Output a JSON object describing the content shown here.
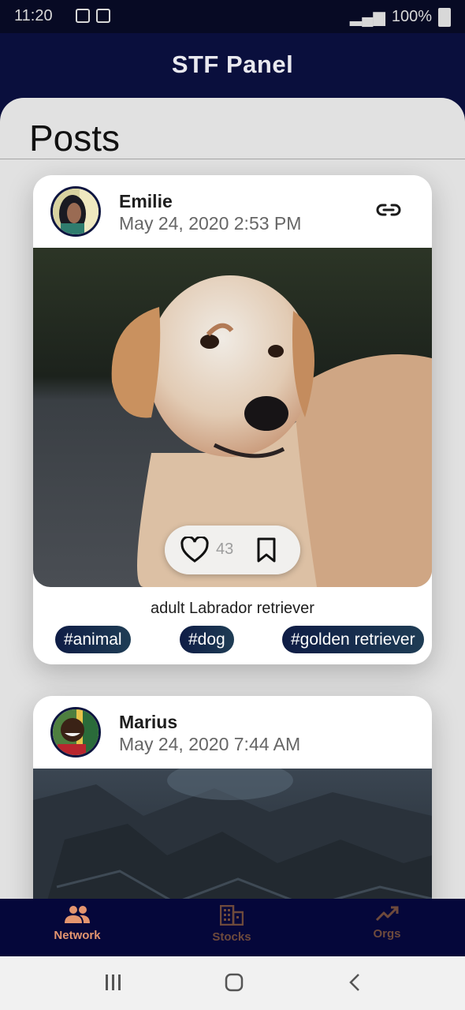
{
  "status_bar": {
    "time": "11:20",
    "battery": "100%"
  },
  "app_bar": {
    "title": "STF Panel"
  },
  "page": {
    "title": "Posts"
  },
  "posts": [
    {
      "author": "Emilie",
      "date": "May 24, 2020 2:53 PM",
      "likes": "43",
      "caption": "adult Labrador retriever",
      "tags": [
        "#animal",
        "#dog",
        "#golden retriever"
      ]
    },
    {
      "author": "Marius",
      "date": "May 24, 2020 7:44 AM"
    }
  ],
  "bottom_nav": {
    "items": [
      {
        "label": "Network",
        "icon": "people-icon",
        "active": true
      },
      {
        "label": "Stocks",
        "icon": "building-icon",
        "active": false
      },
      {
        "label": "Orgs",
        "icon": "trending-up-icon",
        "active": false
      }
    ]
  },
  "colors": {
    "app_bar": "#0a0f3d",
    "nav_active": "#e4956f",
    "nav_inactive": "#6e4a3c",
    "sheet": "#e1e1e1"
  }
}
